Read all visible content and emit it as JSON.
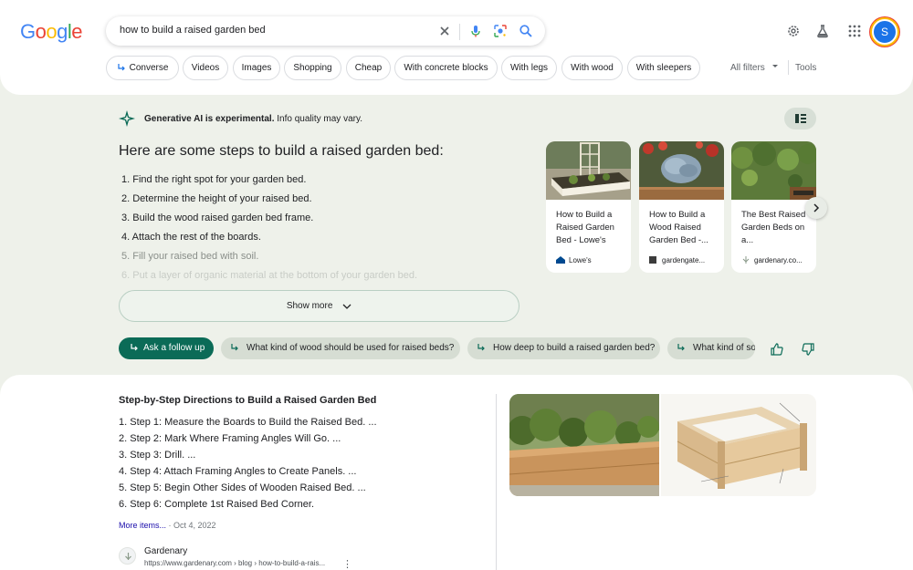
{
  "logo": "Google",
  "search": {
    "query": "how to build a raised garden bed"
  },
  "avatar_letter": "S",
  "chips": [
    {
      "label": "Converse"
    },
    {
      "label": "Videos"
    },
    {
      "label": "Images"
    },
    {
      "label": "Shopping"
    },
    {
      "label": "Cheap"
    },
    {
      "label": "With concrete blocks"
    },
    {
      "label": "With legs"
    },
    {
      "label": "With wood"
    },
    {
      "label": "With sleepers"
    }
  ],
  "filters": {
    "all_filters": "All filters",
    "tools": "Tools"
  },
  "ai": {
    "notice_bold": "Generative AI is experimental.",
    "notice_rest": "Info quality may vary.",
    "heading": "Here are some steps to build a raised garden bed:",
    "steps": [
      "1.  Find the right spot for your garden bed.",
      "2.  Determine the height of your raised bed.",
      "3.  Build the wood raised garden bed frame.",
      "4.  Attach the rest of the boards.",
      "5.  Fill your raised bed with soil.",
      "6.  Put a layer of organic material at the bottom of your garden bed."
    ],
    "show_more": "Show more",
    "cards": [
      {
        "title": "How to Build a Raised Garden Bed - Lowe's",
        "source": "Lowe's"
      },
      {
        "title": "How to Build a Wood Raised Garden Bed -...",
        "source": "gardengate..."
      },
      {
        "title": "The Best Raised Garden Beds on a...",
        "source": "gardenary.co..."
      }
    ],
    "follow_up_primary": "Ask a follow up",
    "follow_ups": [
      "What kind of wood should be used for raised beds?",
      "How deep to build a raised garden bed?",
      "What kind of soil"
    ]
  },
  "snippet": {
    "title": "Step-by-Step Directions to Build a Raised Garden Bed",
    "items": [
      "1. Step 1: Measure the Boards to Build the Raised Bed. ...",
      "2. Step 2: Mark Where Framing Angles Will Go. ...",
      "3. Step 3: Drill. ...",
      "4. Step 4: Attach Framing Angles to Create Panels. ...",
      "5. Step 5: Begin Other Sides of Wooden Raised Bed. ...",
      "6. Step 6: Complete 1st Raised Bed Corner."
    ],
    "more_items": "More items...",
    "date": "Oct 4, 2022",
    "source_name": "Gardenary",
    "source_url": "https://www.gardenary.com › blog › how-to-build-a-rais..."
  },
  "colors": {
    "ai_green": "#0b6b57",
    "page_bg": "#eef1ea",
    "link_blue": "#1a0dab"
  }
}
